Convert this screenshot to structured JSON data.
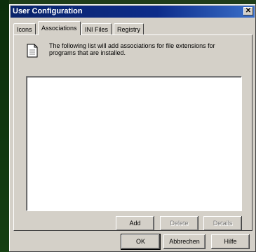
{
  "window": {
    "title": "User Configuration",
    "close_glyph": "✕"
  },
  "tabs": [
    {
      "label": "Icons",
      "active": false
    },
    {
      "label": "Associations",
      "active": true
    },
    {
      "label": "INI Files",
      "active": false
    },
    {
      "label": "Registry",
      "active": false
    }
  ],
  "associations": {
    "description": "The following list will add associations for file extensions for programs that are installed.",
    "icon": "document-icon",
    "items": [],
    "buttons": {
      "add": "Add",
      "delete": "Delete",
      "details": "Details"
    }
  },
  "dialog_buttons": {
    "ok": "OK",
    "cancel": "Abbrechen",
    "help": "Hilfe"
  }
}
